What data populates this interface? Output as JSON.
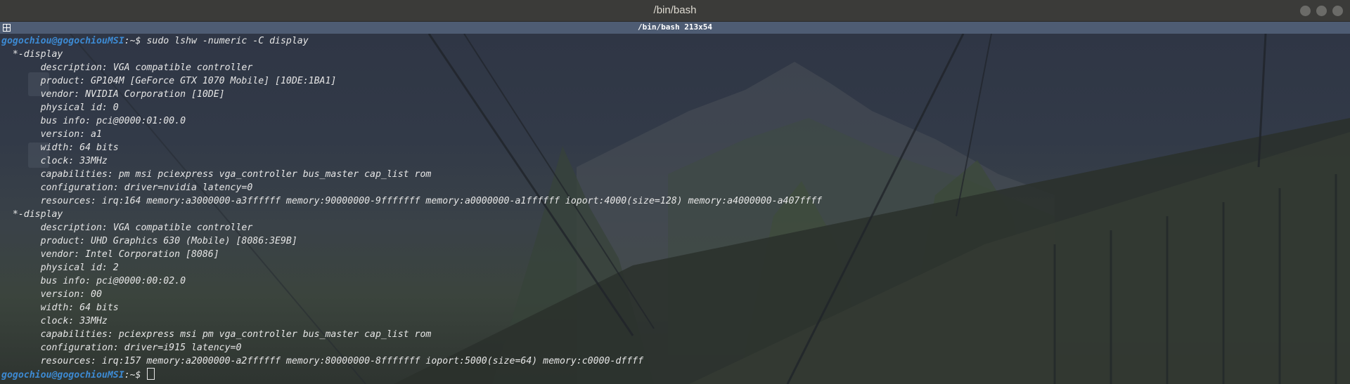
{
  "window": {
    "title": "/bin/bash",
    "controls": [
      "minimize",
      "maximize",
      "close"
    ]
  },
  "terminal_header": {
    "title": "/bin/bash 213x54",
    "icon": "terminator-grid-icon"
  },
  "prompt": {
    "user_host": "gogochiou@gogochiouMSI",
    "path_symbol": ":~$ "
  },
  "command": "sudo lshw -numeric -C display",
  "output": [
    "  *-display",
    "       description: VGA compatible controller",
    "       product: GP104M [GeForce GTX 1070 Mobile] [10DE:1BA1]",
    "       vendor: NVIDIA Corporation [10DE]",
    "       physical id: 0",
    "       bus info: pci@0000:01:00.0",
    "       version: a1",
    "       width: 64 bits",
    "       clock: 33MHz",
    "       capabilities: pm msi pciexpress vga_controller bus_master cap_list rom",
    "       configuration: driver=nvidia latency=0",
    "       resources: irq:164 memory:a3000000-a3ffffff memory:90000000-9fffffff memory:a0000000-a1ffffff ioport:4000(size=128) memory:a4000000-a407ffff",
    "  *-display",
    "       description: VGA compatible controller",
    "       product: UHD Graphics 630 (Mobile) [8086:3E9B]",
    "       vendor: Intel Corporation [8086]",
    "       physical id: 2",
    "       bus info: pci@0000:00:02.0",
    "       version: 00",
    "       width: 64 bits",
    "       clock: 33MHz",
    "       capabilities: pciexpress msi pm vga_controller bus_master cap_list rom",
    "       configuration: driver=i915 latency=0",
    "       resources: irq:157 memory:a2000000-a2ffffff memory:80000000-8fffffff ioport:5000(size=64) memory:c0000-dffff"
  ],
  "colors": {
    "prompt_user": "#3d8ad3",
    "text": "#e6e6e6",
    "titlebar": "#3b3b39",
    "terminal_header": "#4e5c73"
  }
}
